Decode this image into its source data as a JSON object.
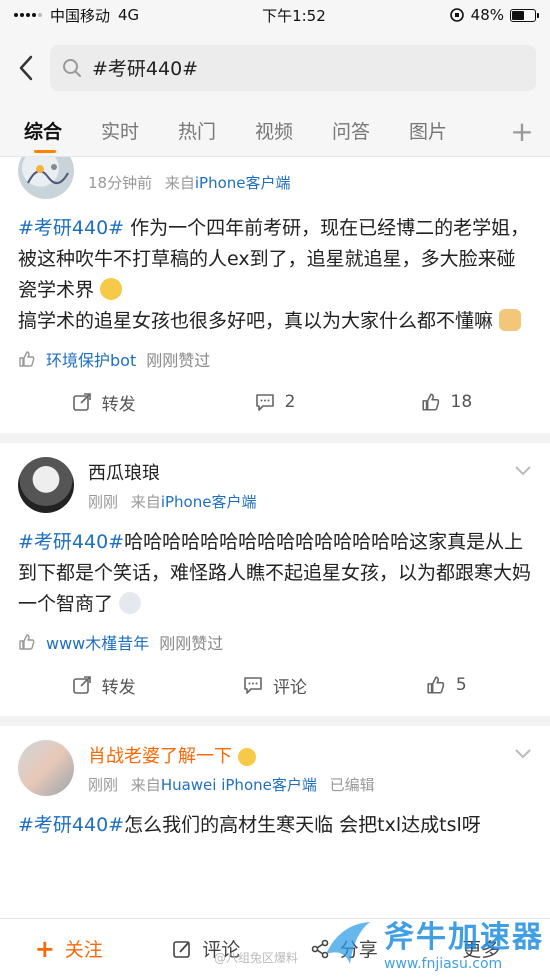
{
  "status": {
    "carrier": "中国移动",
    "network": "4G",
    "time": "下午1:52",
    "battery": "48%",
    "battery_level": 0.48
  },
  "search": {
    "query": "#考研440#"
  },
  "tabs": [
    {
      "label": "综合",
      "active": true
    },
    {
      "label": "实时"
    },
    {
      "label": "热门"
    },
    {
      "label": "视频"
    },
    {
      "label": "问答"
    },
    {
      "label": "图片"
    }
  ],
  "tab_add": "+",
  "posts": [
    {
      "time": "18分钟前",
      "from_prefix": "来自",
      "source": "iPhone客户端",
      "tag": "#考研440#",
      "text": " 作为一个四年前考研，现在已经博二的老学姐，被这种吹牛不打草稿的人ex到了，追星就追星，多大脸来碰瓷学术界",
      "text2": "搞学术的追星女孩也很多好吧，真以为大家什么都不懂嘛",
      "liked_by": "环境保护bot",
      "liked_suffix": "刚刚赞过",
      "repost": "转发",
      "comments": "2",
      "likes": "18"
    },
    {
      "name": "西瓜琅琅",
      "time": "刚刚",
      "from_prefix": "来自",
      "source": "iPhone客户端",
      "tag": "#考研440#",
      "text": "哈哈哈哈哈哈哈哈哈哈哈哈哈哈哈这家真是从上到下都是个笑话，难怪路人瞧不起追星女孩，以为都跟寒大妈一个智商了",
      "liked_by": "www木槿昔年",
      "liked_suffix": "刚刚赞过",
      "repost": "转发",
      "comments": "评论",
      "likes": "5"
    },
    {
      "name": "肖战老婆了解一下",
      "time": "刚刚",
      "from_prefix": "来自",
      "source": "Huawei iPhone客户端",
      "edited": "已编辑",
      "tag": "#考研440#",
      "text": "怎么我们的高材生寒天临 会把txl达成tsl呀"
    }
  ],
  "bottom_bar": {
    "follow": "关注",
    "comment": "评论",
    "share": "分享",
    "more": "更多"
  },
  "watermark": {
    "title": "斧牛加速器",
    "url": "www.fnjiasu.com",
    "credit": "@八组兔区爆料"
  },
  "colors": {
    "accent": "#ff8200",
    "link": "#1e6fc2",
    "vip_name": "#f86a08"
  }
}
